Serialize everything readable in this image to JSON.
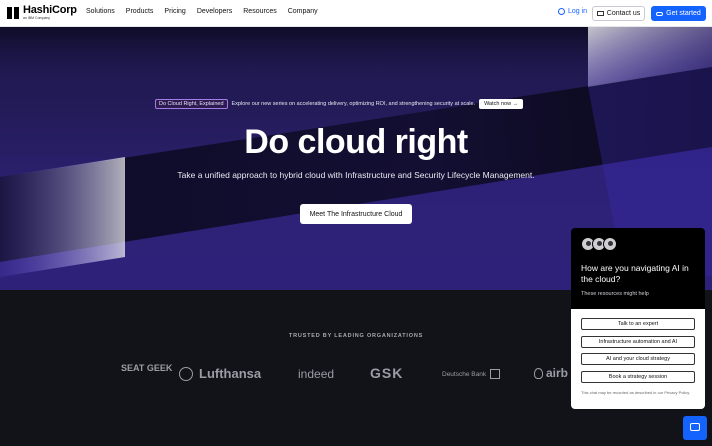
{
  "nav": {
    "brand": "HashiCorp",
    "brand_sub": "an IBM Company",
    "menu": [
      "Solutions",
      "Products",
      "Pricing",
      "Developers",
      "Resources",
      "Company"
    ],
    "login": "Log in",
    "contact": "Contact us",
    "get_started": "Get started"
  },
  "hero": {
    "banner_tag": "Do Cloud Right, Explained",
    "banner_text": "Explore our new series on accelerating delivery, optimizing ROI, and strengthening security at scale.",
    "banner_button": "Watch now →",
    "title": "Do cloud right",
    "subtitle": "Take a unified approach to hybrid cloud with Infrastructure and Security Lifecycle Management.",
    "cta": "Meet The Infrastructure Cloud"
  },
  "trusted": {
    "label": "TRUSTED BY LEADING ORGANIZATIONS",
    "brands": [
      "SEAT GEEK",
      "Lufthansa",
      "indeed",
      "GSK",
      "Deutsche Bank",
      "airb"
    ]
  },
  "chat": {
    "title": "How are you navigating AI in the cloud?",
    "subtitle": "These resources might help",
    "options": [
      "Talk to an expert",
      "Infrastructure automation and AI",
      "AI and your cloud strategy",
      "Book a strategy session"
    ],
    "note": "This chat may be recorded as described in our Privacy Policy."
  },
  "colors": {
    "accent": "#1563ff",
    "hero_dark": "#121318",
    "hero_purple": "#2a1f6b"
  }
}
